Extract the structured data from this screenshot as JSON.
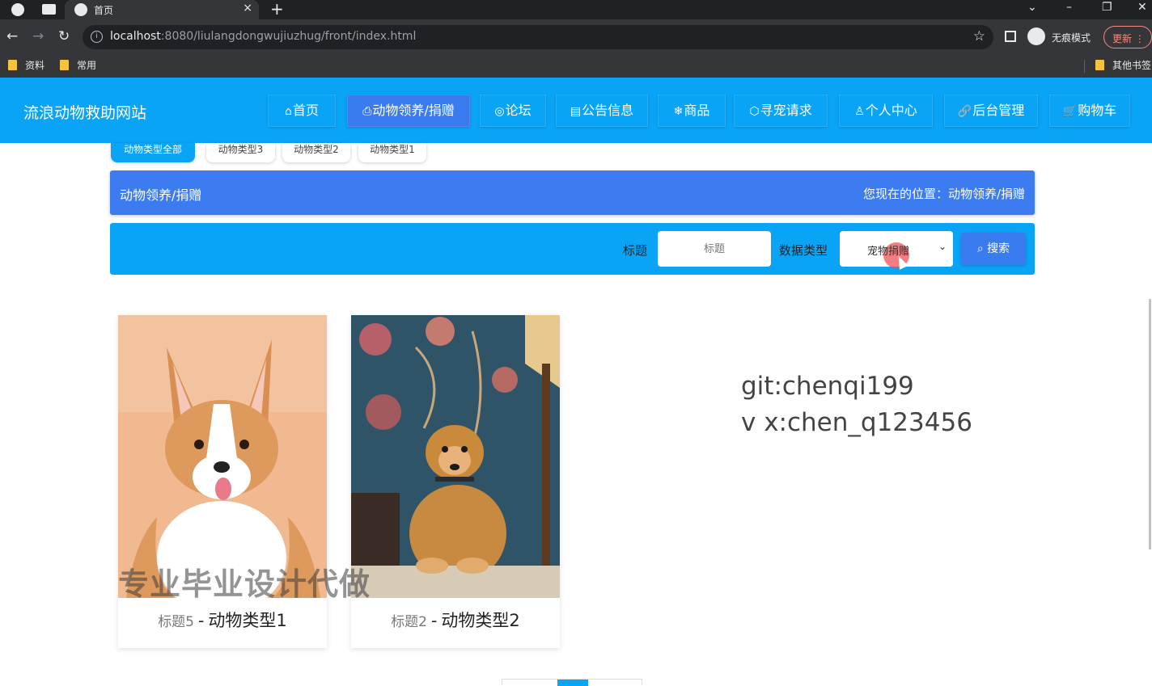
{
  "browser": {
    "tab_title": "首页",
    "url_host": "localhost",
    "url_rest": ":8080/liulangdongwujiuzhug/front/index.html",
    "incognito_label": "无痕模式",
    "update_label": "更新",
    "bookmarks": [
      "资料",
      "常用",
      "其他书签"
    ]
  },
  "site": {
    "title": "流浪动物救助网站",
    "nav": [
      {
        "icon": "⌂",
        "label": "首页"
      },
      {
        "icon": "⎙",
        "label": "动物领养/捐赠"
      },
      {
        "icon": "◎",
        "label": "论坛"
      },
      {
        "icon": "▤",
        "label": "公告信息"
      },
      {
        "icon": "❄",
        "label": "商品"
      },
      {
        "icon": "⬡",
        "label": "寻宠请求"
      },
      {
        "icon": "♙",
        "label": "个人中心"
      },
      {
        "icon": "🔗",
        "label": "后台管理"
      },
      {
        "icon": "🛒",
        "label": "购物车"
      }
    ]
  },
  "categories": [
    "动物类型全部",
    "动物类型3",
    "动物类型2",
    "动物类型1"
  ],
  "section": {
    "title": "动物领养/捐赠",
    "crumb": "您现在的位置：动物领养/捐赠"
  },
  "search": {
    "title_label": "标题",
    "title_placeholder": "标题",
    "type_label": "数据类型",
    "type_value": "宠物捐赠",
    "button_label": "搜索"
  },
  "cards": [
    {
      "title": "标题5",
      "separator": "-",
      "type": "动物类型1"
    },
    {
      "title": "标题2",
      "separator": "-",
      "type": "动物类型2"
    }
  ],
  "watermark": "专业毕业设计代做",
  "side_note": {
    "line1": "git:chenqi199",
    "line2": "v x:chen_q123456"
  }
}
